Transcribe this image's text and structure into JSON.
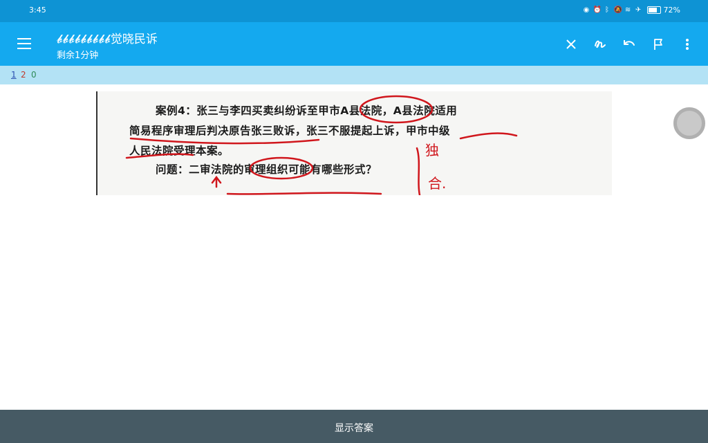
{
  "status_bar": {
    "time": "3:45",
    "battery": "72%",
    "icons": [
      "eye-icon",
      "alarm-icon",
      "bluetooth-icon",
      "mute-icon",
      "wifi-icon",
      "airplane-icon",
      "battery-icon"
    ]
  },
  "toolbar": {
    "title": "𝓫𝓫𝓫𝓫𝓫𝓫𝓫𝓫𝓫觉晓民诉",
    "subtitle": "剩余1分钟",
    "actions": [
      "close-icon",
      "draw-icon",
      "undo-icon",
      "flag-icon",
      "more-icon"
    ]
  },
  "counts": {
    "new": "1",
    "learning": "2",
    "review": "0"
  },
  "card": {
    "line1": "案例4：张三与李四买卖纠纷诉至甲市A县法院，A县法院适用",
    "line2": "简易程序审理后判决原告张三败诉，张三不服提起上诉，甲市中级",
    "line3": "人民法院受理本案。",
    "line4": "问题：二审法院的审理组织可能有哪些形式？",
    "annotation1": "独",
    "annotation2": "合."
  },
  "bottom": {
    "show_answer": "显示答案"
  },
  "colors": {
    "status_bar": "#0e93d4",
    "toolbar": "#14a9ef",
    "counter_bar": "#b3e2f5",
    "bottom_bar": "#465a64",
    "ink": "#d0161c"
  }
}
